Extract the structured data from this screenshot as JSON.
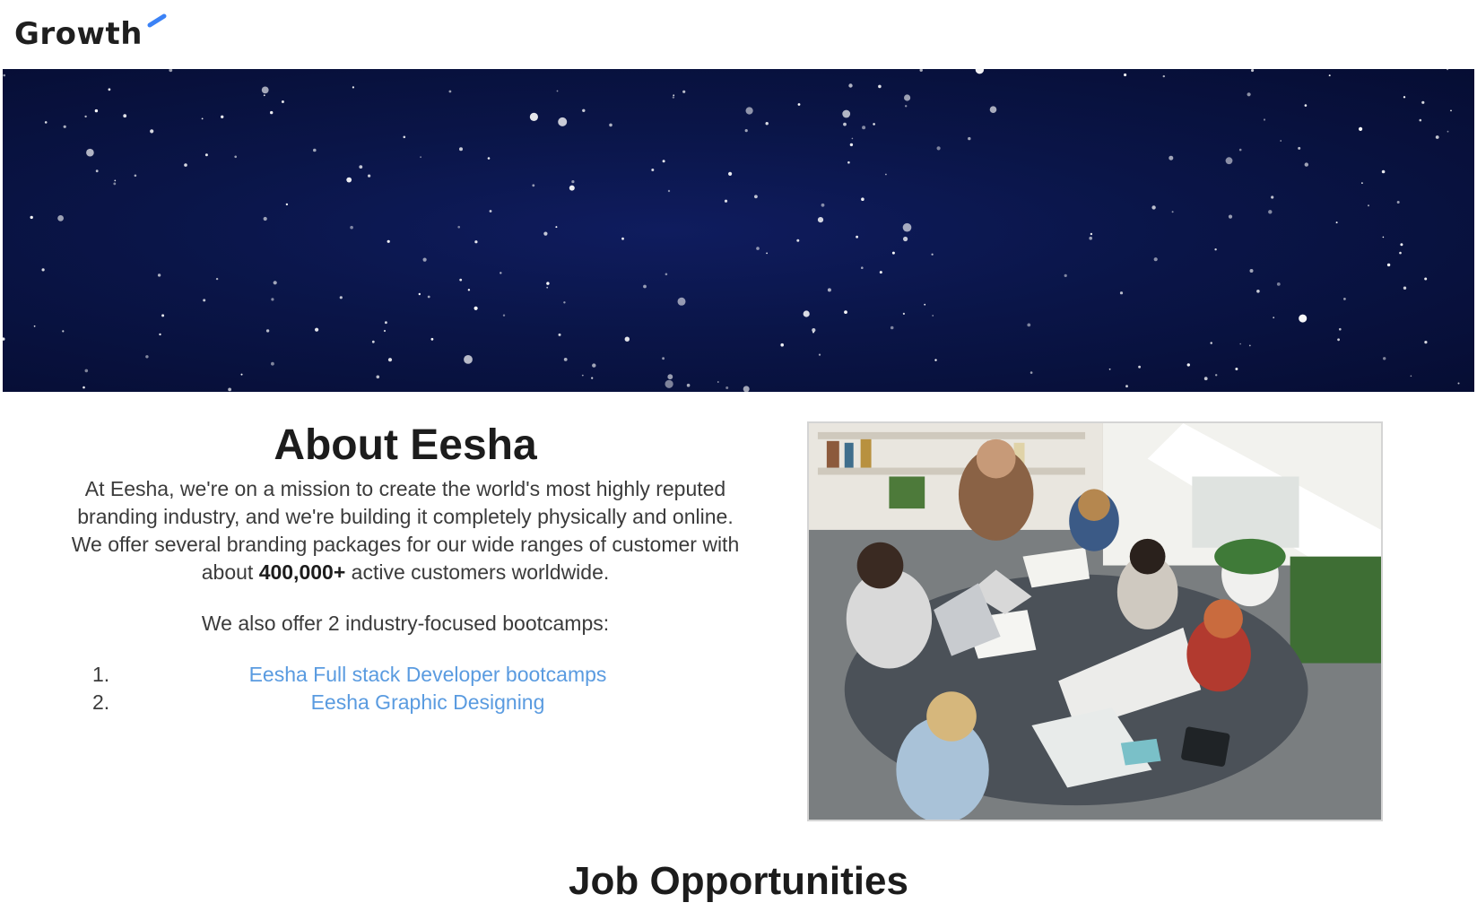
{
  "header": {
    "logo_text": "Growth",
    "accent_color": "#3b82f6"
  },
  "hero": {
    "image": "starry-night-sky-banner"
  },
  "about": {
    "title": "About Eesha",
    "body_part1": "At Eesha, we're on a mission to create the world's most highly reputed branding industry, and we're building it completely physically and online. We offer several branding packages for our wide ranges of customer with about",
    "body_highlight": "400,000+",
    "body_part2": "active customers worldwide.",
    "offer_text": "We also offer 2 industry-focused bootcamps:",
    "bootcamps": [
      {
        "number": "1.",
        "label": "Eesha Full stack Developer bootcamps"
      },
      {
        "number": "2.",
        "label": "Eesha Graphic Designing"
      }
    ],
    "link_color": "#5a9be0"
  },
  "photo": {
    "image": "team-meeting-around-table-photo"
  },
  "jobs": {
    "title": "Job Opportunities"
  }
}
